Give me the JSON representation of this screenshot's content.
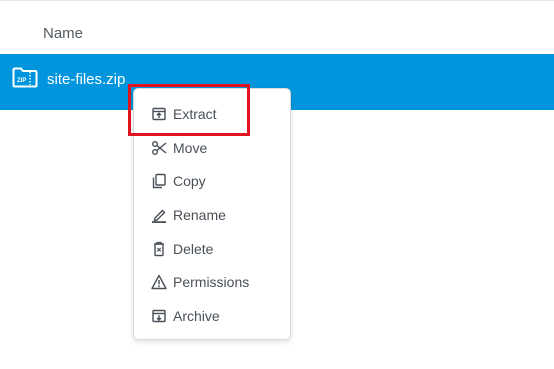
{
  "file_list": {
    "column_header": "Name"
  },
  "selected_file": {
    "name": "site-files.zip",
    "icon": "zip-folder-icon",
    "icon_badge": "ZIP",
    "row_color": "#0095dd"
  },
  "context_menu": {
    "items": [
      {
        "label": "Extract",
        "icon": "extract-icon"
      },
      {
        "label": "Move",
        "icon": "scissors-icon"
      },
      {
        "label": "Copy",
        "icon": "copy-icon"
      },
      {
        "label": "Rename",
        "icon": "pencil-icon"
      },
      {
        "label": "Delete",
        "icon": "trash-icon"
      },
      {
        "label": "Permissions",
        "icon": "warning-icon"
      },
      {
        "label": "Archive",
        "icon": "archive-icon"
      }
    ]
  },
  "highlight": {
    "target": "Extract",
    "color": "#e0141e"
  }
}
